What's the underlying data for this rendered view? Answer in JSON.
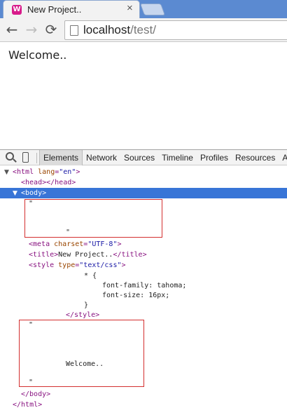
{
  "browser": {
    "tab": {
      "title": "New Project..",
      "favicon_letter": "W",
      "close_glyph": "×"
    },
    "toolbar": {
      "back_glyph": "←",
      "forward_glyph": "→",
      "reload_glyph": "⟳"
    },
    "address": {
      "host": "localhost",
      "path": "/test/"
    }
  },
  "page": {
    "welcome_text": "Welcome.."
  },
  "devtools": {
    "tabs": [
      "Elements",
      "Network",
      "Sources",
      "Timeline",
      "Profiles",
      "Resources",
      "Au"
    ],
    "active_tab": "Elements",
    "tree": {
      "html_open_tag": "<html",
      "html_lang_attr": "lang",
      "html_lang_value": "\"en\"",
      "html_open_close": ">",
      "head_line": "<head></head>",
      "body_open": "<body>",
      "text_node_1_quote_top": "\"",
      "text_node_1_quote_bottom": "\"",
      "meta_tag_start": "<meta",
      "meta_attr": "charset",
      "meta_value": "\"UTF-8\"",
      "meta_tag_end": ">",
      "title_open": "<title>",
      "title_text": "New Project..",
      "title_close": "</title>",
      "style_open": "<style",
      "style_attr": "type",
      "style_value": "\"text/css\"",
      "style_open_end": ">",
      "css_selector": "* {",
      "css_font_family": "font-family: tahoma;",
      "css_font_size": "font-size: 16px;",
      "css_close": "}",
      "style_close": "</style>",
      "text_node_2_quote_top": "\"",
      "text_node_2_text": "Welcome..",
      "text_node_2_quote_bottom": "\"",
      "body_close": "</body>",
      "html_close": "</html>"
    }
  },
  "colors": {
    "tag": "#881280",
    "attribute_name": "#994500",
    "attribute_value": "#1a1aa6",
    "selection": "#3875d7",
    "highlight_box": "#d32f2f"
  }
}
